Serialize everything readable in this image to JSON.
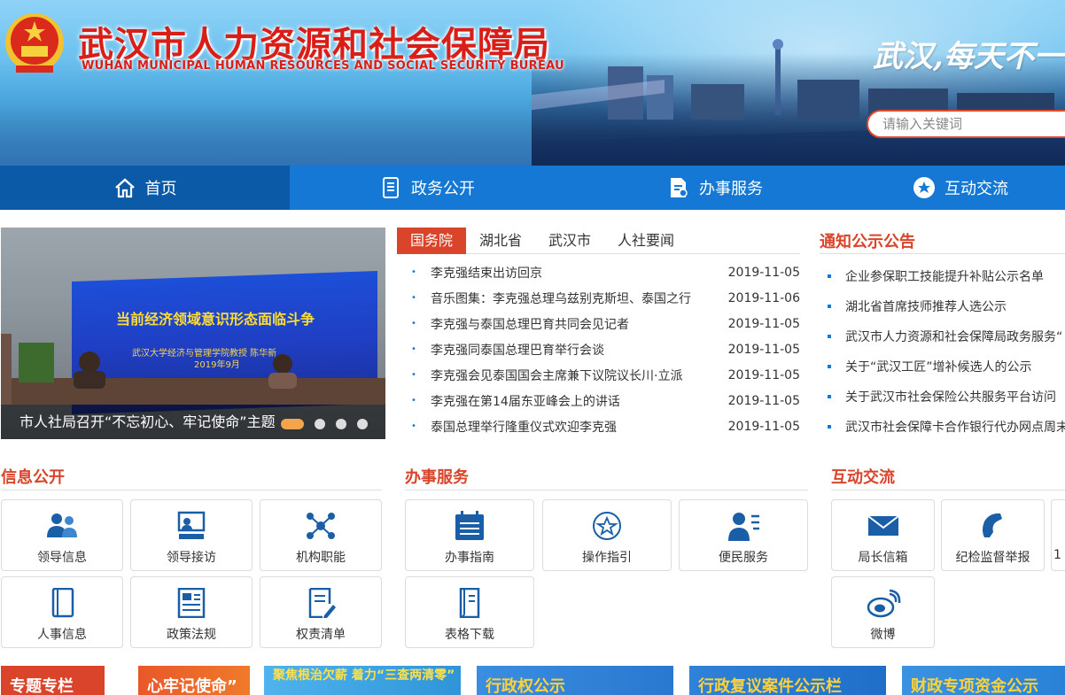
{
  "header": {
    "title_cn": "武汉市人力资源和社会保障局",
    "title_en": "WUHAN MUNICIPAL HUMAN RESOURCES AND SOCIAL SECURITY BUREAU",
    "slogan": "武汉,每天不一",
    "search_placeholder": "请输入关键词"
  },
  "nav": {
    "items": [
      {
        "label": "首页",
        "icon": "home-icon",
        "active": true
      },
      {
        "label": "政务公开",
        "icon": "document-icon"
      },
      {
        "label": "办事服务",
        "icon": "service-doc-icon"
      },
      {
        "label": "互动交流",
        "icon": "star-circle-icon"
      }
    ]
  },
  "slider": {
    "caption": "市人社局召开“不忘初心、牢记使命”主题",
    "screen_title": "当前经济领域意识形态面临斗争",
    "screen_sub": "武汉大学经济与管理学院教授 陈华新",
    "screen_date": "2019年9月",
    "dots": 4,
    "active_dot": 0
  },
  "news": {
    "tabs": [
      "国务院",
      "湖北省",
      "武汉市",
      "人社要闻"
    ],
    "active_tab": 0,
    "items": [
      {
        "title": "李克强结束出访回京",
        "date": "2019-11-05"
      },
      {
        "title": "音乐图集：李克强总理乌兹别克斯坦、泰国之行",
        "date": "2019-11-06"
      },
      {
        "title": "李克强与泰国总理巴育共同会见记者",
        "date": "2019-11-05"
      },
      {
        "title": "李克强同泰国总理巴育举行会谈",
        "date": "2019-11-05"
      },
      {
        "title": "李克强会见泰国国会主席兼下议院议长川·立派",
        "date": "2019-11-05"
      },
      {
        "title": "李克强在第14届东亚峰会上的讲话",
        "date": "2019-11-05"
      },
      {
        "title": "泰国总理举行隆重仪式欢迎李克强",
        "date": "2019-11-05"
      }
    ]
  },
  "notices": {
    "title": "通知公示公告",
    "items": [
      "企业参保职工技能提升补贴公示名单",
      "湖北省首席技师推荐人选公示",
      "武汉市人力资源和社会保障局政务服务“",
      "关于“武汉工匠”增补候选人的公示",
      "关于武汉市社会保险公共服务平台访问",
      "武汉市社会保障卡合作银行代办网点周末"
    ]
  },
  "sections": {
    "info": {
      "title": "信息公开",
      "tiles": [
        {
          "label": "领导信息",
          "icon": "leaders-icon"
        },
        {
          "label": "领导接访",
          "icon": "reception-icon"
        },
        {
          "label": "机构职能",
          "icon": "org-network-icon"
        },
        {
          "label": "人事信息",
          "icon": "book-icon"
        },
        {
          "label": "政策法规",
          "icon": "newspaper-icon"
        },
        {
          "label": "权责清单",
          "icon": "list-edit-icon"
        }
      ]
    },
    "service": {
      "title": "办事服务",
      "tiles": [
        {
          "label": "办事指南",
          "icon": "calendar-list-icon"
        },
        {
          "label": "操作指引",
          "icon": "star-badge-icon"
        },
        {
          "label": "便民服务",
          "icon": "person-list-icon"
        },
        {
          "label": "表格下载",
          "icon": "form-download-icon"
        }
      ]
    },
    "interact": {
      "title": "互动交流",
      "tiles": [
        {
          "label": "局长信箱",
          "icon": "mail-icon"
        },
        {
          "label": "纪检监督举报",
          "icon": "phone-icon"
        },
        {
          "label": "1",
          "icon": "partial-icon"
        },
        {
          "label": "微博",
          "icon": "weibo-icon"
        }
      ]
    }
  },
  "promos": [
    {
      "text": "专题专栏",
      "color": "#d9442a"
    },
    {
      "text": "心牢记使命”",
      "color": "#e8582a"
    },
    {
      "text": "聚焦根治欠薪 着力“三查两清零”",
      "color": "#2f95d8"
    },
    {
      "text": "行政权公示",
      "color": "#2a78d0"
    },
    {
      "text": "行政复议案件公示栏",
      "color": "#1f6fc9"
    },
    {
      "text": "财政专项资金公示",
      "color": "#2a82d8"
    }
  ],
  "colors": {
    "brand_red": "#d9442a",
    "nav_blue": "#1478d4",
    "nav_active": "#0b5aa8",
    "icon_blue": "#1a5ea8"
  }
}
